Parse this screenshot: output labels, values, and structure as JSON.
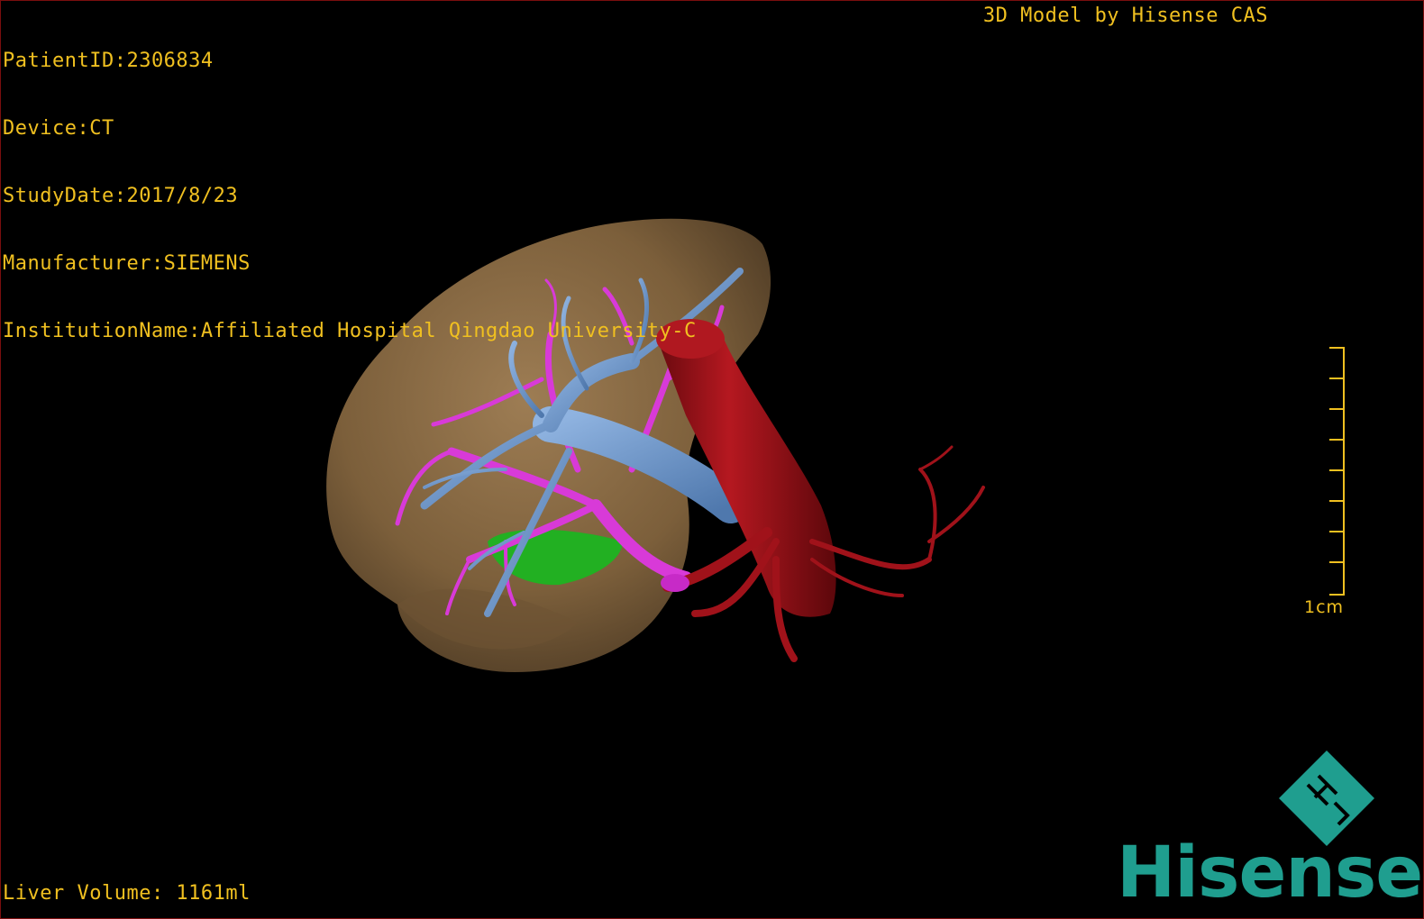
{
  "viewer": {
    "info_lines": [
      "PatientID:2306834",
      "Device:CT",
      "StudyDate:2017/8/23",
      "Manufacturer:SIEMENS",
      "InstitutionName:Affiliated Hospital Qingdao University-C"
    ],
    "model_credit": "3D Model by Hisense CAS",
    "liver_volume": "Liver Volume: 1161ml",
    "scale_label": "1cm",
    "brand_word": "Hisense",
    "colors": {
      "overlay_text": "#f0c020",
      "liver": "#8a6a45",
      "hepatic_vein": "#6b95c9",
      "portal_vein": "#d83ad8",
      "artery_aorta": "#a0121a",
      "gallbladder": "#22b022",
      "brand": "#1f9e8f",
      "frame": "#7a0e0e"
    },
    "icons": [
      "hisense-logo-icon",
      "scale-bar-icon"
    ]
  }
}
